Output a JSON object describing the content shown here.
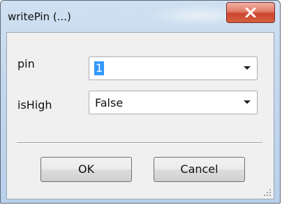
{
  "window": {
    "title": "writePin (...)"
  },
  "form": {
    "pin": {
      "label": "pin",
      "value": "1"
    },
    "isHigh": {
      "label": "isHigh",
      "value": "False"
    }
  },
  "buttons": {
    "ok": "OK",
    "cancel": "Cancel"
  },
  "icons": {
    "close": "close-icon",
    "dropdown": "chevron-down-icon",
    "grip": "resize-grip-icon"
  }
}
